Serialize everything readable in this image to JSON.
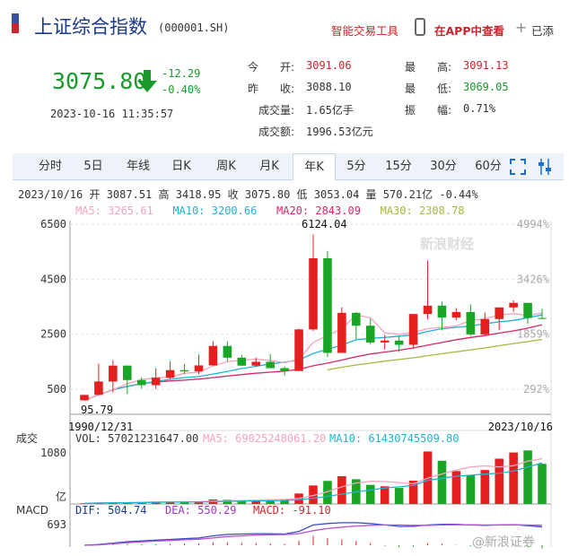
{
  "header": {
    "title": "上证综合指数",
    "code": "(000001.SH)",
    "tools_link": "智能交易工具",
    "app_link": "在APP中查看",
    "added_label": "已添"
  },
  "quote": {
    "price": "3075.80",
    "change": "-12.29",
    "change_pct": "-0.40%",
    "time": "2023-10-16 11:35:57",
    "fields": [
      {
        "label": "今　　开:",
        "value": "3091.06",
        "color": "red"
      },
      {
        "label": "最　　高:",
        "value": "3091.13",
        "color": "red"
      },
      {
        "label": "昨　　收:",
        "value": "3088.10",
        "color": "normal"
      },
      {
        "label": "最　　低:",
        "value": "3069.05",
        "color": "green"
      },
      {
        "label": "成交量:",
        "value": "1.65亿手",
        "color": "normal"
      },
      {
        "label": "振　　幅:",
        "value": "0.71%",
        "color": "normal"
      },
      {
        "label": "成交额:",
        "value": "1996.53亿元",
        "color": "normal"
      }
    ]
  },
  "tabs": [
    "分时",
    "5日",
    "日K",
    "周K",
    "月K",
    "年K",
    "5分",
    "15分",
    "30分",
    "60分"
  ],
  "tabs_order": [
    "分时",
    "5日",
    "年线",
    "日K",
    "周K",
    "月K",
    "年K",
    "5分",
    "15分",
    "30分",
    "60分"
  ],
  "active_tab": "年K",
  "ohlc_line": "2023/10/16 开 3087.51 高 3418.95 收 3075.80 低 3053.04 量 570.21亿 -0.44%",
  "ma_legend": {
    "ma5": "MA5: 3265.61",
    "ma10": "MA10: 3200.66",
    "ma20": "MA20: 2843.09",
    "ma30": "MA30: 2308.78"
  },
  "volume_legend": {
    "label": "成交",
    "vol": "VOL: 57021231647.00",
    "ma5": "MA5: 69025248061.20",
    "ma10": "MA10: 61430745509.80",
    "unit": "亿",
    "top": "1080"
  },
  "macd_legend": {
    "label": "MACD",
    "dif": "DIF: 504.74",
    "dea": "DEA: 550.29",
    "macd": "MACD: -91.10",
    "top": "693"
  },
  "colors": {
    "up": "#e41f1f",
    "down": "#1aa526",
    "ma5": "#f4a4c0",
    "ma10": "#22b2d4",
    "ma20": "#d4286a",
    "ma30": "#a8b83a",
    "title_blue": "#1b3a8c"
  },
  "watermark": "新浪财经",
  "footer_watermark": "@新浪证券",
  "chart_data": {
    "type": "candlestick",
    "y_ticks": [
      6500,
      4500,
      2500,
      500
    ],
    "y_right_ticks": [
      "4994%",
      "3426%",
      "1859%",
      "292%"
    ],
    "ylim": [
      0,
      6500
    ],
    "x_start_label": "1990/12/31",
    "x_end_label": "2023/10/16",
    "high_annotation": "6124.04",
    "low_annotation": "95.79",
    "candles": [
      {
        "o": 96,
        "h": 293,
        "l": 96,
        "c": 293
      },
      {
        "o": 293,
        "h": 1429,
        "l": 293,
        "c": 780
      },
      {
        "o": 780,
        "h": 1558,
        "l": 386,
        "c": 1358
      },
      {
        "o": 1358,
        "h": 1052,
        "l": 325,
        "c": 833
      },
      {
        "o": 833,
        "h": 927,
        "l": 524,
        "c": 647
      },
      {
        "o": 647,
        "h": 1258,
        "l": 512,
        "c": 917
      },
      {
        "o": 917,
        "h": 1510,
        "l": 870,
        "c": 1194
      },
      {
        "o": 1194,
        "h": 1422,
        "l": 1047,
        "c": 1147
      },
      {
        "o": 1147,
        "h": 1757,
        "l": 1047,
        "c": 1366
      },
      {
        "o": 1366,
        "h": 2245,
        "l": 1361,
        "c": 2073
      },
      {
        "o": 2073,
        "h": 2245,
        "l": 1514,
        "c": 1646
      },
      {
        "o": 1646,
        "h": 1748,
        "l": 1339,
        "c": 1357
      },
      {
        "o": 1357,
        "h": 1649,
        "l": 1311,
        "c": 1497
      },
      {
        "o": 1497,
        "h": 1783,
        "l": 1259,
        "c": 1266
      },
      {
        "o": 1266,
        "h": 1328,
        "l": 998,
        "c": 1161
      },
      {
        "o": 1161,
        "h": 2698,
        "l": 1161,
        "c": 2675
      },
      {
        "o": 2675,
        "h": 6124,
        "l": 2617,
        "c": 5261
      },
      {
        "o": 5261,
        "h": 5522,
        "l": 1664,
        "c": 1820
      },
      {
        "o": 1820,
        "h": 3478,
        "l": 1844,
        "c": 3277
      },
      {
        "o": 3277,
        "h": 3306,
        "l": 2319,
        "c": 2808
      },
      {
        "o": 2808,
        "h": 3067,
        "l": 2134,
        "c": 2199
      },
      {
        "o": 2199,
        "h": 2478,
        "l": 1949,
        "c": 2269
      },
      {
        "o": 2269,
        "h": 2444,
        "l": 1849,
        "c": 2115
      },
      {
        "o": 2115,
        "h": 3239,
        "l": 1974,
        "c": 3234
      },
      {
        "o": 3234,
        "h": 5178,
        "l": 3049,
        "c": 3539
      },
      {
        "o": 3539,
        "h": 3684,
        "l": 2638,
        "c": 3103
      },
      {
        "o": 3103,
        "h": 3450,
        "l": 3016,
        "c": 3307
      },
      {
        "o": 3307,
        "h": 3587,
        "l": 2440,
        "c": 2494
      },
      {
        "o": 2494,
        "h": 3288,
        "l": 2440,
        "c": 3050
      },
      {
        "o": 3050,
        "h": 3474,
        "l": 2646,
        "c": 3473
      },
      {
        "o": 3473,
        "h": 3731,
        "l": 3312,
        "c": 3640
      },
      {
        "o": 3640,
        "h": 3424,
        "l": 2886,
        "c": 3089
      },
      {
        "o": 3089,
        "h": 3419,
        "l": 3053,
        "c": 3076
      }
    ],
    "ma5": [
      96,
      293,
      480,
      700,
      850,
      920,
      930,
      1080,
      1116,
      1340,
      1500,
      1560,
      1590,
      1550,
      1460,
      1600,
      2200,
      2450,
      2700,
      3200,
      3100,
      2550,
      2500,
      2560,
      2700,
      2750,
      2800,
      3000,
      3060,
      3200,
      3250,
      3180,
      3266
    ],
    "ma10": [
      96,
      293,
      480,
      600,
      700,
      780,
      860,
      920,
      960,
      1050,
      1150,
      1250,
      1330,
      1420,
      1480,
      1560,
      1800,
      1950,
      2100,
      2300,
      2350,
      2380,
      2430,
      2480,
      2600,
      2700,
      2750,
      2800,
      2880,
      2950,
      3000,
      3100,
      3201
    ],
    "ma20": [
      96,
      293,
      480,
      600,
      700,
      760,
      800,
      830,
      870,
      920,
      980,
      1030,
      1080,
      1120,
      1160,
      1220,
      1350,
      1450,
      1560,
      1680,
      1780,
      1850,
      1920,
      2000,
      2100,
      2200,
      2300,
      2380,
      2450,
      2540,
      2620,
      2720,
      2843
    ],
    "ma30": [
      null,
      null,
      null,
      null,
      null,
      null,
      null,
      null,
      null,
      null,
      null,
      null,
      null,
      null,
      null,
      null,
      null,
      1200,
      1300,
      1380,
      1450,
      1520,
      1580,
      1640,
      1720,
      1790,
      1860,
      1930,
      2000,
      2080,
      2160,
      2230,
      2309
    ],
    "volume": [
      0.3,
      0.5,
      0.8,
      0.6,
      0.9,
      1.2,
      1.0,
      1.1,
      1.3,
      2.2,
      2.1,
      1.6,
      1.9,
      1.8,
      2.3,
      5.1,
      9.0,
      11.2,
      13.5,
      12.0,
      9.3,
      8.6,
      7.8,
      11.3,
      25.5,
      21.0,
      16.0,
      14.0,
      16.5,
      22.0,
      25.0,
      26.0,
      19.5
    ],
    "vol_ma5": [
      0.3,
      0.5,
      0.6,
      0.7,
      0.8,
      1.0,
      1.0,
      1.1,
      1.1,
      1.4,
      1.6,
      1.7,
      1.9,
      2.0,
      2.2,
      2.8,
      4.1,
      6.0,
      8.3,
      10.2,
      11.0,
      10.9,
      10.4,
      9.8,
      12.5,
      14.6,
      16.5,
      18.0,
      18.5,
      18.0,
      18.6,
      20.8,
      22.0
    ],
    "vol_ma10": [
      0.3,
      0.5,
      0.6,
      0.6,
      0.7,
      0.8,
      0.9,
      0.9,
      1.0,
      1.1,
      1.3,
      1.4,
      1.5,
      1.6,
      1.7,
      2.1,
      2.8,
      3.7,
      4.8,
      5.9,
      6.8,
      7.8,
      8.3,
      9.0,
      11.5,
      12.5,
      13.5,
      14.0,
      14.5,
      15.0,
      16.0,
      18.0,
      20.0
    ],
    "vol_max": 27,
    "macd_hist": [
      0,
      5,
      20,
      30,
      25,
      28,
      35,
      40,
      45,
      80,
      85,
      70,
      60,
      50,
      40,
      120,
      260,
      200,
      160,
      120,
      60,
      -20,
      -60,
      -40,
      60,
      40,
      10,
      -30,
      -20,
      20,
      40,
      -60,
      -91
    ],
    "dif": [
      0,
      20,
      60,
      100,
      120,
      140,
      160,
      180,
      200,
      260,
      300,
      310,
      320,
      320,
      310,
      380,
      560,
      600,
      620,
      620,
      600,
      560,
      520,
      520,
      560,
      580,
      580,
      560,
      550,
      560,
      570,
      540,
      505
    ],
    "dea": [
      0,
      10,
      40,
      70,
      95,
      115,
      130,
      150,
      165,
      200,
      240,
      260,
      280,
      290,
      295,
      320,
      400,
      460,
      500,
      530,
      550,
      560,
      560,
      550,
      550,
      560,
      565,
      565,
      560,
      560,
      565,
      560,
      550
    ],
    "macd_max": 693
  }
}
